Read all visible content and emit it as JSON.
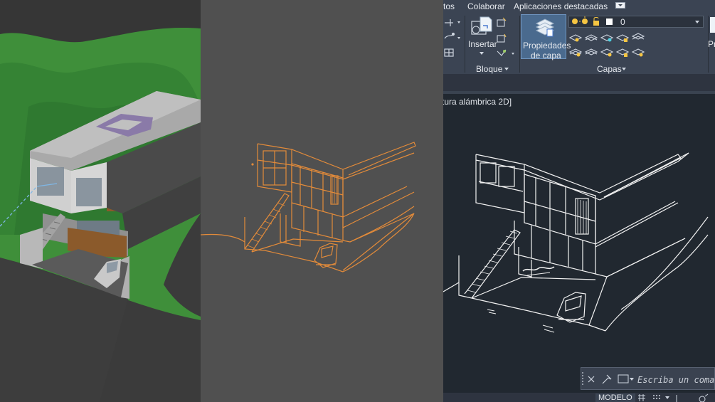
{
  "menu": {
    "tab_partial": "tos",
    "tab_collaborate": "Colaborar",
    "tab_featured_apps": "Aplicaciones destacadas"
  },
  "ribbon": {
    "insert_label": "Insertar",
    "block_panel_label": "Bloque",
    "layer_properties_line1": "Propiedades",
    "layer_properties_line2": "de capa",
    "layers_panel_label": "Capas",
    "current_layer": "0",
    "cut_off_label": "Pr"
  },
  "viewport": {
    "title": "tura alámbrica 2D]"
  },
  "command_line": {
    "placeholder": "Escriba un coman"
  },
  "status_bar": {
    "model_tab": "MODELO"
  },
  "colors": {
    "wire_orange": "#e38b3a",
    "wire_white": "#f2f2f2",
    "grass_green": "#3f8f3a",
    "cad_background": "#212830",
    "ribbon_background": "#3b4453",
    "selection_blue": "#4a6a8e"
  }
}
